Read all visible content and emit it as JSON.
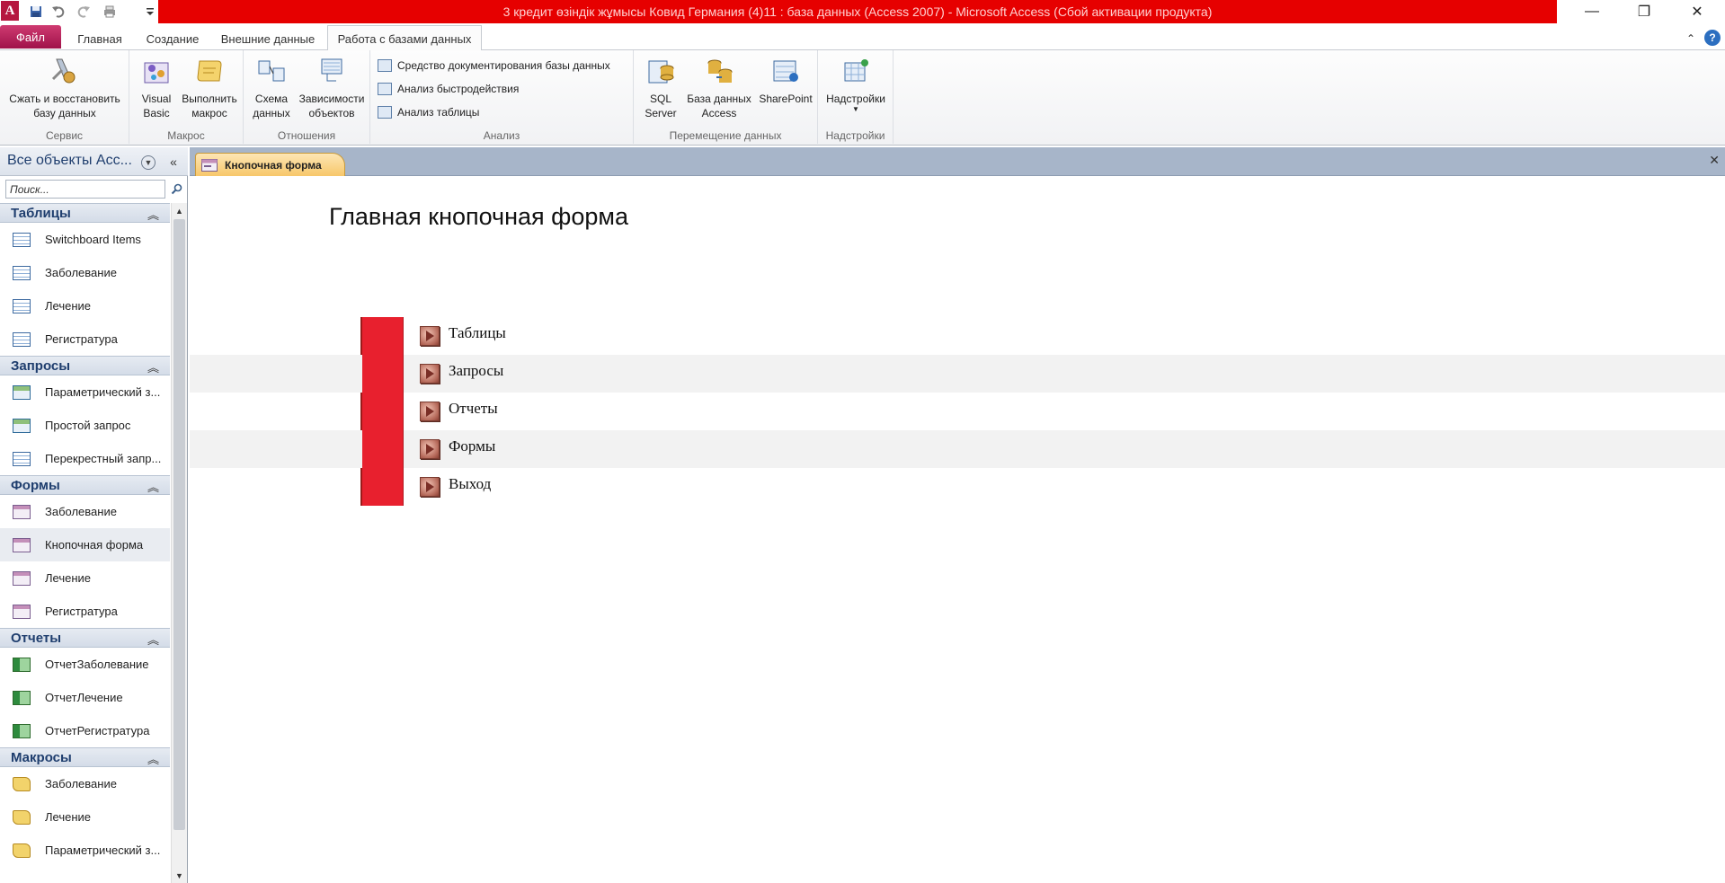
{
  "window": {
    "title": "3 кредит өзіндік жұмысы Ковид Германия (4)11 : база данных (Access 2007)  -  Microsoft Access (Сбой активации продукта)",
    "app_icon_letter": "A",
    "minimize": "—",
    "maximize": "❐",
    "close": "✕"
  },
  "quick_access": {
    "save_icon": "save-icon",
    "undo_icon": "undo-icon",
    "redo_icon": "redo-icon",
    "print_icon": "print-icon",
    "customize_icon": "customize-icon"
  },
  "ribbon_tabs": {
    "file": "Файл",
    "tabs": [
      "Главная",
      "Создание",
      "Внешние данные",
      "Работа с базами данных"
    ],
    "active_index": 3,
    "minimize_ribbon": "⌃",
    "help": "?"
  },
  "ribbon": {
    "groups": {
      "service": "Сервис",
      "macro": "Макрос",
      "relations": "Отношения",
      "analysis": "Анализ",
      "move": "Перемещение данных",
      "addins": "Надстройки"
    },
    "buttons": {
      "compact": "Сжать и восстановить базу данных",
      "visual_basic": "Visual Basic",
      "run_macro": "Выполнить макрос",
      "schema": "Схема данных",
      "dependencies": "Зависимости объектов",
      "documenter": "Средство документирования базы данных",
      "performance": "Анализ быстродействия",
      "analyze_table": "Анализ таблицы",
      "sql_server": "SQL Server",
      "access_db": "База данных Access",
      "sharepoint": "SharePoint",
      "addins": "Надстройки"
    }
  },
  "nav": {
    "title": "Все объекты Acc...",
    "search_placeholder": "Поиск...",
    "collapse": "«",
    "groups": [
      {
        "label": "Таблицы",
        "type": "table",
        "items": [
          "Switchboard Items",
          "Заболевание",
          "Лечение",
          "Регистратура"
        ]
      },
      {
        "label": "Запросы",
        "type": "query",
        "items": [
          "Параметрический з...",
          "Простой запрос",
          "Перекрестный запр..."
        ]
      },
      {
        "label": "Формы",
        "type": "form",
        "items": [
          "Заболевание",
          "Кнопочная форма",
          "Лечение",
          "Регистратура"
        ]
      },
      {
        "label": "Отчеты",
        "type": "report",
        "items": [
          "ОтчетЗаболевание",
          "ОтчетЛечение",
          "ОтчетРегистратура"
        ]
      },
      {
        "label": "Макросы",
        "type": "macro",
        "items": [
          "Заболевание",
          "Лечение",
          "Параметрический з..."
        ]
      }
    ],
    "selected": "Кнопочная форма"
  },
  "document": {
    "tab_label": "Кнопочная форма",
    "close": "✕",
    "form_title": "Главная кнопочная форма",
    "buttons": [
      "Таблицы",
      "Запросы",
      "Отчеты",
      "Формы",
      "Выход"
    ]
  },
  "colors": {
    "title_bar": "#e60000",
    "file_tab": "#b5173f",
    "switch_bar": "#e8202e",
    "doc_tab": "#f7c76a"
  }
}
